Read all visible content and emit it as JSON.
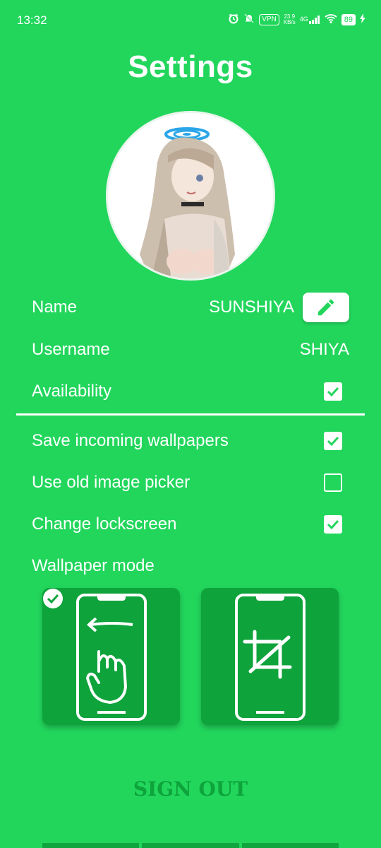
{
  "status_bar": {
    "time": "13:32",
    "vpn": "VPN",
    "net_speed_value": "23.9",
    "net_speed_unit": "KB/s",
    "network": "4G",
    "battery": "89"
  },
  "title": "Settings",
  "profile": {
    "name_label": "Name",
    "name_value": "SUNSHIYA",
    "username_label": "Username",
    "username_value": "SHIYA",
    "availability_label": "Availability",
    "availability_checked": true
  },
  "options": [
    {
      "label": "Save incoming wallpapers",
      "checked": true
    },
    {
      "label": "Use old image picker",
      "checked": false
    },
    {
      "label": "Change lockscreen",
      "checked": true
    }
  ],
  "wallpaper_mode": {
    "label": "Wallpaper mode",
    "modes": [
      {
        "name": "scroll",
        "selected": true
      },
      {
        "name": "crop",
        "selected": false
      }
    ]
  },
  "sign_out_label": "SIGN OUT",
  "colors": {
    "background": "#22d65c",
    "card": "#0ea33b",
    "accent_text": "#0ea33b",
    "white": "#ffffff"
  }
}
